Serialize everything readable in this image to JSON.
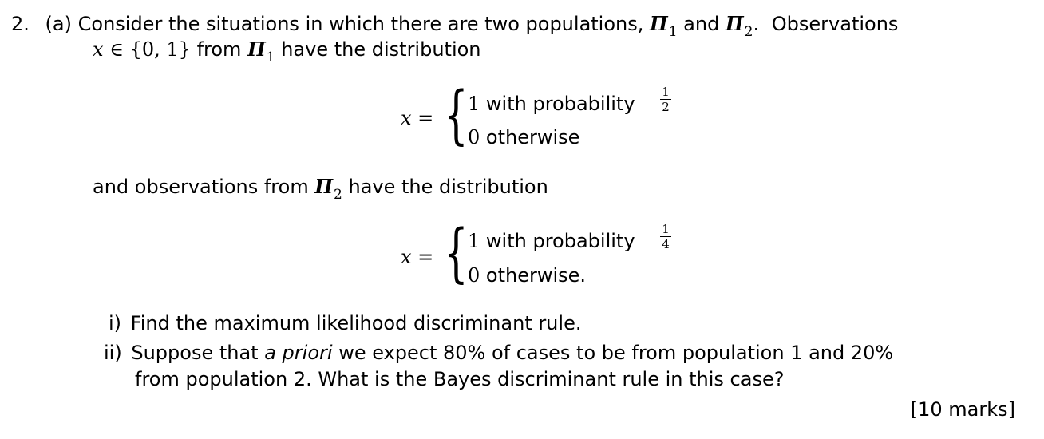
{
  "question": {
    "number": "2.",
    "part": "(a)",
    "intro_1": "Consider the situations in which there are two populations,",
    "pi_symbol": "Π",
    "sub_1": "1",
    "sub_2": "2",
    "and": "and",
    "period": ".",
    "observations": "Observations",
    "x": "x",
    "in_set": "∈ {0, 1}",
    "from": "from",
    "have_dist": "have the distribution",
    "and_obs_from": "and observations from",
    "marks": "[10 marks]"
  },
  "dist_1": {
    "lhs": "x =",
    "case1_val": "1",
    "case1_text": "with probability",
    "case1_frac_num": "1",
    "case1_frac_den": "2",
    "case2_val": "0",
    "case2_text": "otherwise"
  },
  "dist_2": {
    "lhs": "x =",
    "case1_val": "1",
    "case1_text": "with probability",
    "case1_frac_num": "1",
    "case1_frac_den": "4",
    "case2_val": "0",
    "case2_text": "otherwise."
  },
  "subquestions": [
    {
      "label": "i)",
      "text": "Find the maximum likelihood discriminant rule."
    },
    {
      "label": "ii)",
      "text_pre": "Suppose that",
      "text_em": "a priori",
      "text_post": "we expect 80% of cases to be from population 1 and 20%",
      "text_line2": "from population 2. What is the Bayes discriminant rule in this case?"
    }
  ]
}
